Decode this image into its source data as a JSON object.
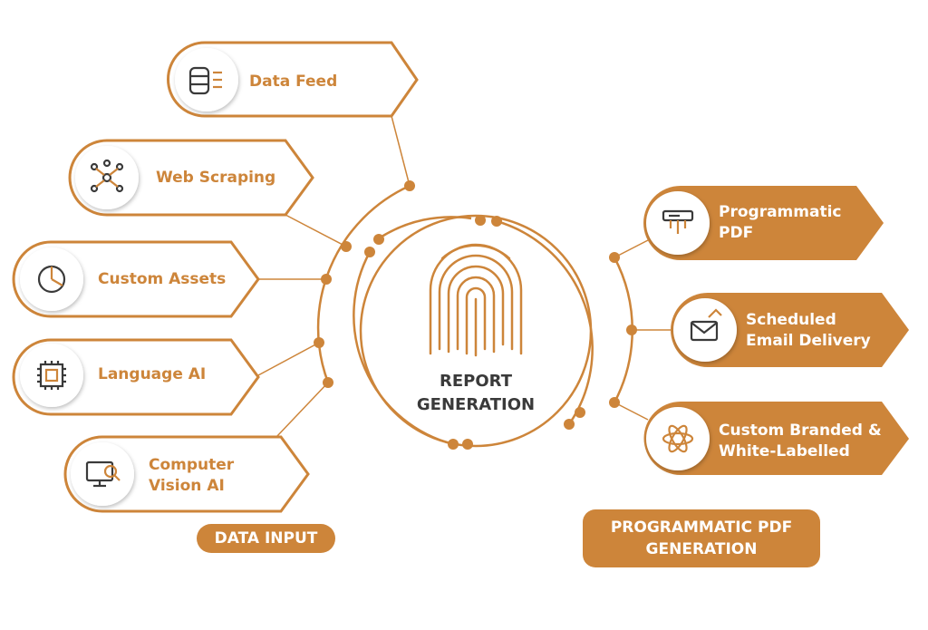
{
  "colors": {
    "accent": "#cd853a",
    "text_dark": "#3a3a3a",
    "icon": "#3a3a3a"
  },
  "center": {
    "line1": "REPORT",
    "line2": "GENERATION",
    "icon": "fingerprint-icon"
  },
  "inputs": [
    {
      "label": "Data Feed",
      "icon": "database-icon"
    },
    {
      "label": "Web Scraping",
      "icon": "network-icon"
    },
    {
      "label": "Custom Assets",
      "icon": "pie-chart-icon"
    },
    {
      "label": "Language AI",
      "icon": "chip-icon"
    },
    {
      "label": "Computer Vision AI",
      "line1": "Computer",
      "line2": "Vision AI",
      "icon": "monitor-search-icon"
    }
  ],
  "outputs": [
    {
      "line1": "Programmatic",
      "line2": "PDF",
      "icon": "circuit-board-icon"
    },
    {
      "line1": "Scheduled",
      "line2": "Email Delivery",
      "icon": "email-icon"
    },
    {
      "line1": "Custom Branded &",
      "line2": "White-Labelled",
      "icon": "atom-icon"
    }
  ],
  "tags": {
    "left": "DATA INPUT",
    "right_line1": "PROGRAMMATIC PDF",
    "right_line2": "GENERATION"
  }
}
